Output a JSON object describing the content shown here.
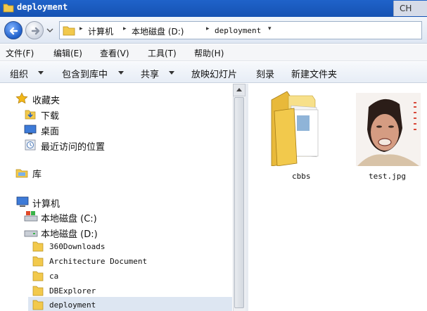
{
  "window": {
    "title": "deployment",
    "lang_indicator": "CH"
  },
  "address": {
    "crumbs": [
      "计算机",
      "本地磁盘 (D:)",
      "deployment"
    ]
  },
  "menu": {
    "items": [
      "文件(F)",
      "编辑(E)",
      "查看(V)",
      "工具(T)",
      "帮助(H)"
    ]
  },
  "toolbar": {
    "organize": "组织",
    "include_library": "包含到库中",
    "share": "共享",
    "slideshow": "放映幻灯片",
    "burn": "刻录",
    "new_folder": "新建文件夹"
  },
  "nav": {
    "favorites": {
      "label": "收藏夹",
      "items": [
        "下载",
        "桌面",
        "最近访问的位置"
      ]
    },
    "libraries": {
      "label": "库"
    },
    "computer": {
      "label": "计算机",
      "drives": [
        "本地磁盘 (C:)",
        "本地磁盘 (D:)"
      ],
      "folders": [
        "360Downloads",
        "Architecture Document",
        "ca",
        "DBExplorer",
        "deployment"
      ]
    }
  },
  "files": [
    {
      "name": "cbbs",
      "type": "folder"
    },
    {
      "name": "test.jpg",
      "type": "image"
    }
  ],
  "colors": {
    "titlebar": "#1f62c9",
    "selection": "#dde6f2",
    "folder": "#f2c94c"
  },
  "icons": [
    "back-arrow-icon",
    "forward-arrow-icon",
    "folder-icon",
    "star-icon",
    "download-icon",
    "desktop-icon",
    "recent-places-icon",
    "library-icon",
    "computer-icon",
    "drive-icon"
  ]
}
